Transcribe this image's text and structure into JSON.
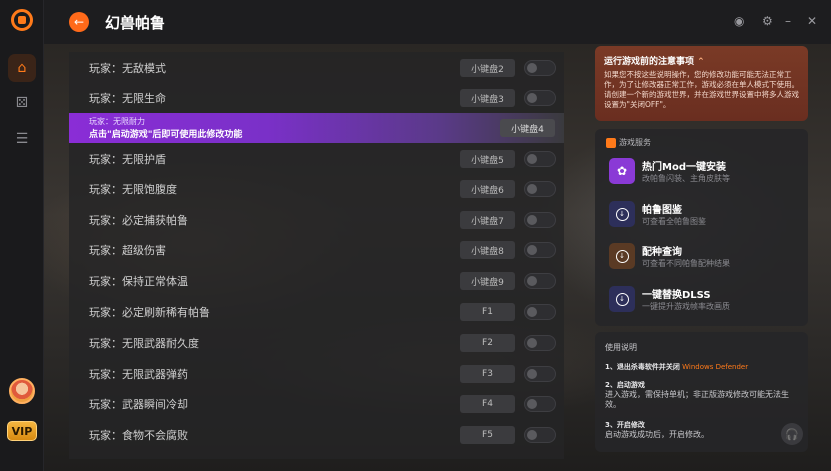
{
  "header": {
    "title": "幻兽帕鲁",
    "back_icon": "arrow-left-icon"
  },
  "sidebar": {
    "vip_label": "VIP"
  },
  "cheats": [
    {
      "name": "玩家：无敌模式",
      "key": "小键盘2"
    },
    {
      "name": "玩家：无限生命",
      "key": "小键盘3"
    },
    {
      "name": "玩家：无限耐力",
      "key": "小键盘4",
      "hint": "点击\"启动游戏\"后即可使用此修改功能"
    },
    {
      "name": "玩家：无限护盾",
      "key": "小键盘5"
    },
    {
      "name": "玩家：无限饱腹度",
      "key": "小键盘6"
    },
    {
      "name": "玩家：必定捕获帕鲁",
      "key": "小键盘7"
    },
    {
      "name": "玩家：超级伤害",
      "key": "小键盘8"
    },
    {
      "name": "玩家：保持正常体温",
      "key": "小键盘9"
    },
    {
      "name": "玩家：必定刷新稀有帕鲁",
      "key": "F1"
    },
    {
      "name": "玩家：无限武器耐久度",
      "key": "F2"
    },
    {
      "name": "玩家：无限武器弹药",
      "key": "F3"
    },
    {
      "name": "玩家：武器瞬间冷却",
      "key": "F4"
    },
    {
      "name": "玩家：食物不会腐败",
      "key": "F5"
    }
  ],
  "notice": {
    "title": "运行游戏前的注意事项",
    "body": "如果您不按这些说明操作，您的修改功能可能无法正常工作，为了让修改器正常工作，游戏必须在单人模式下使用。请创建一个新的游戏世界，并在游戏世界设置中将多人游戏设置为\"关闭OFF\"。"
  },
  "services": {
    "heading": "游戏服务",
    "items": [
      {
        "title": "热门Mod一键安装",
        "desc": "改帕鲁闪装、主角皮肤等",
        "color": "#8a3ad6"
      },
      {
        "title": "帕鲁图鉴",
        "desc": "可查看全帕鲁图鉴",
        "color": "#2d2f5a"
      },
      {
        "title": "配种查询",
        "desc": "可查看不同帕鲁配种结果",
        "color": "#5a3a24"
      },
      {
        "title": "一键替换DLSS",
        "desc": "一键提升游戏帧率改画质",
        "color": "#2d2f5a"
      }
    ]
  },
  "guide": {
    "title": "使用说明",
    "step1_title": "1、退出杀毒软件并关闭",
    "step1_highlight": "Windows Defender",
    "step2_title": "2、启动游戏",
    "step2_body": "进入游戏，需保持单机；非正版游戏修改可能无法生效。",
    "step3_title": "3、开启修改",
    "step3_body": "启动游戏成功后，开启修改。"
  }
}
